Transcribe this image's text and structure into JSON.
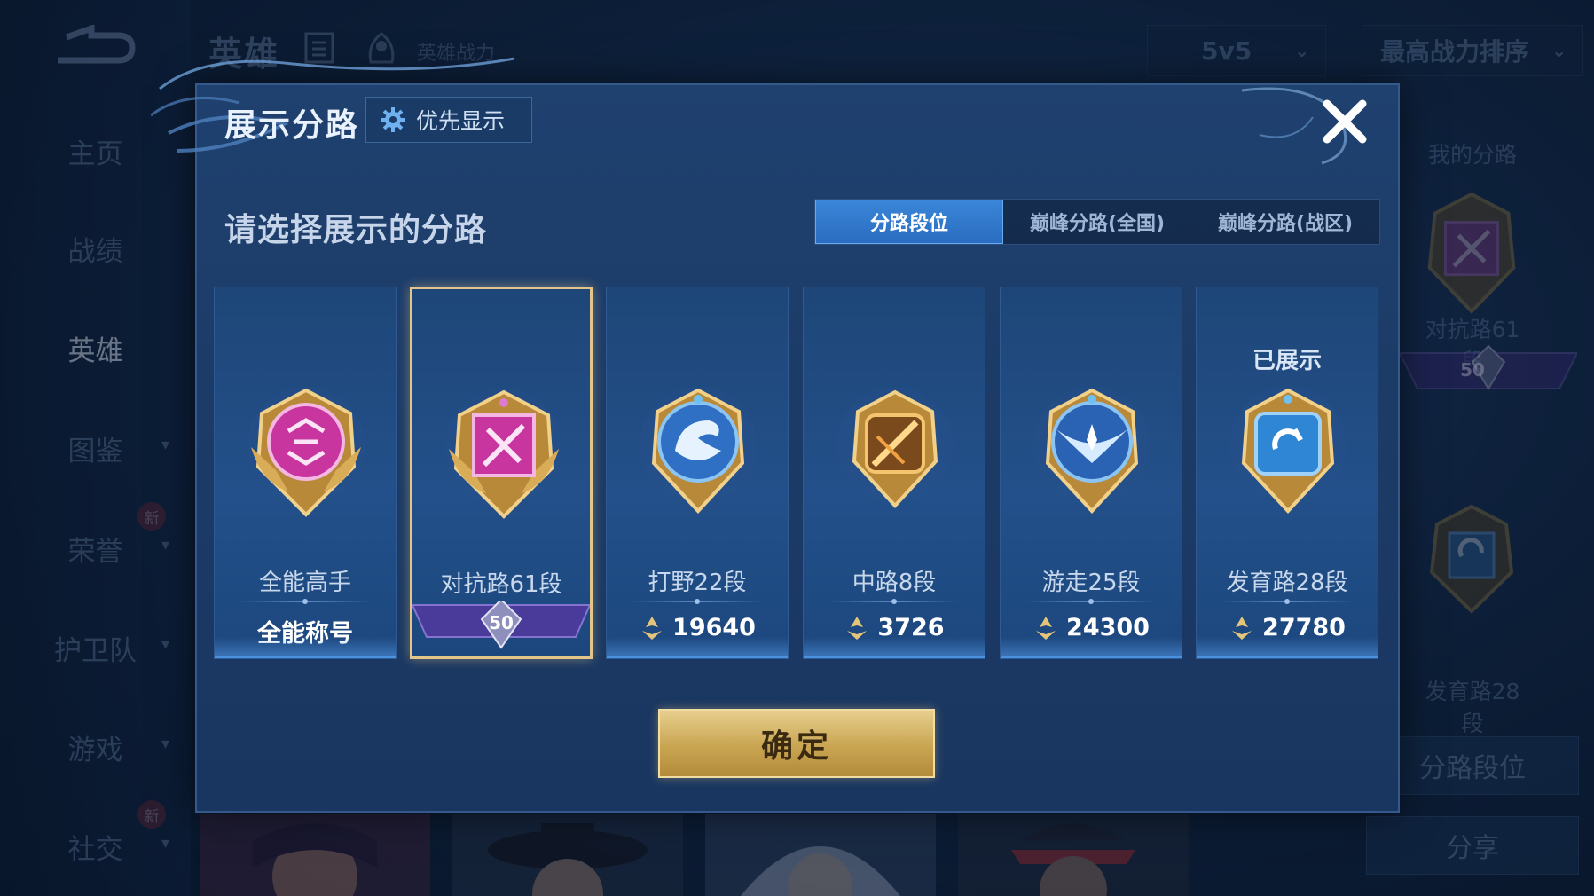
{
  "background": {
    "nav": [
      {
        "label": "主页",
        "chevron": false,
        "badge": ""
      },
      {
        "label": "战绩",
        "chevron": false,
        "badge": ""
      },
      {
        "label": "英雄",
        "chevron": false,
        "badge": "",
        "active": true
      },
      {
        "label": "图鉴",
        "chevron": true,
        "badge": ""
      },
      {
        "label": "荣誉",
        "chevron": true,
        "badge": "新"
      },
      {
        "label": "护卫队",
        "chevron": true,
        "badge": ""
      },
      {
        "label": "游戏",
        "chevron": true,
        "badge": ""
      },
      {
        "label": "社交",
        "chevron": true,
        "badge": "新"
      }
    ],
    "header_title": "英雄",
    "power_label": "英雄战力",
    "mode_dropdown": "5v5",
    "sort_dropdown": "最高战力排序",
    "right_panel": {
      "title": "我的分路",
      "top_lane_label": "对抗路61段",
      "top_lane_badge": "50",
      "bottom_lane_label": "发育路28段",
      "lane_rank_button": "分路段位",
      "share_button": "分享"
    }
  },
  "dialog": {
    "title": "展示分路",
    "priority_button": "优先显示",
    "subtitle": "请选择展示的分路",
    "tabs": [
      {
        "label": "分路段位",
        "active": true
      },
      {
        "label": "巅峰分路(全国)",
        "active": false
      },
      {
        "label": "巅峰分路(战区)",
        "active": false
      }
    ],
    "cards": [
      {
        "label": "全能高手",
        "value": "全能称号",
        "value_icon": false,
        "status": "",
        "emblem": "all-round-emblem",
        "color": "#d23fbf",
        "selected": false
      },
      {
        "label": "对抗路61段",
        "value": "",
        "badge": "50",
        "status": "",
        "emblem": "clash-lane-emblem",
        "color": "#d23fbf",
        "selected": true
      },
      {
        "label": "打野22段",
        "value": "19640",
        "value_icon": true,
        "status": "",
        "emblem": "jungle-emblem",
        "color": "#3b8fe6",
        "selected": false
      },
      {
        "label": "中路8段",
        "value": "3726",
        "value_icon": true,
        "status": "",
        "emblem": "mid-lane-emblem",
        "color": "#e6a53b",
        "selected": false
      },
      {
        "label": "游走25段",
        "value": "24300",
        "value_icon": true,
        "status": "",
        "emblem": "roam-emblem",
        "color": "#3b8fe6",
        "selected": false
      },
      {
        "label": "发育路28段",
        "value": "27780",
        "value_icon": true,
        "status": "已展示",
        "emblem": "farm-lane-emblem",
        "color": "#3b9fe6",
        "selected": false
      }
    ],
    "confirm_button": "确定"
  },
  "colors": {
    "accent_blue": "#2a6cc0",
    "gold": "#e3c58a",
    "dialog_bg": "#1c3b67"
  }
}
